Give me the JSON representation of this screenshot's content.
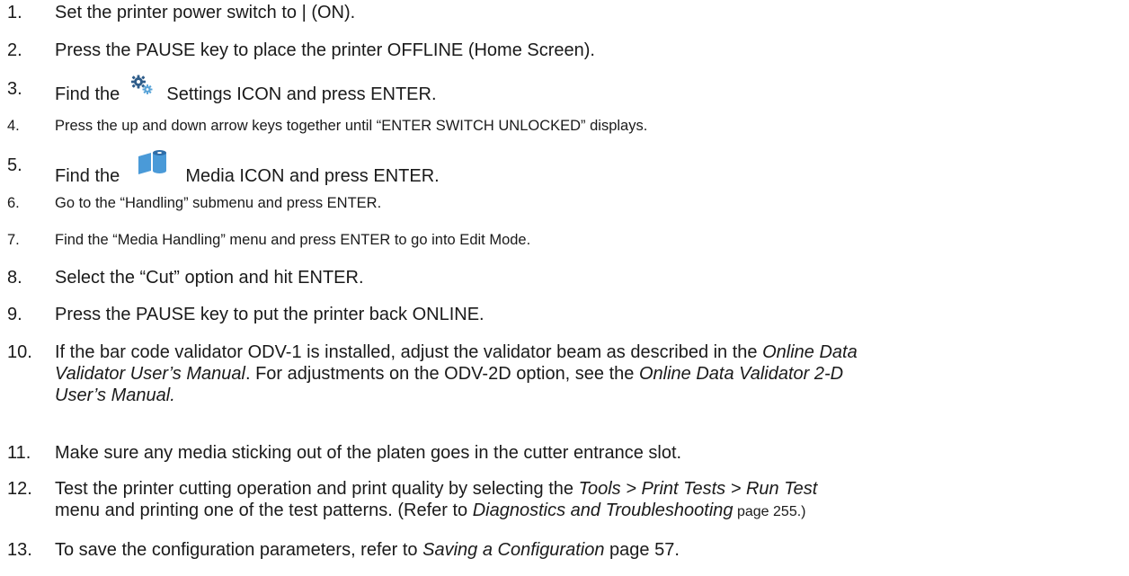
{
  "steps": [
    {
      "num": "1.",
      "text": "Set the printer power switch to | (ON)."
    },
    {
      "num": "2.",
      "text": "Press the PAUSE key to place the printer OFFLINE (Home Screen)."
    },
    {
      "num": "3.",
      "pre": "Find the",
      "icon": "settings-gear-icon",
      "post": "Settings ICON and press ENTER."
    },
    {
      "num": "4.",
      "text": "Press the up and down arrow keys together until “ENTER SWITCH UNLOCKED” displays."
    },
    {
      "num": "5.",
      "pre": "Find the",
      "icon": "media-roll-icon",
      "post": "Media ICON and press ENTER."
    },
    {
      "num": "6.",
      "text": "Go to the “Handling” submenu and press ENTER."
    },
    {
      "num": "7.",
      "text": "Find the “Media Handling” menu and press ENTER to go into Edit Mode."
    },
    {
      "num": "8.",
      "text": "Select the “Cut” option and hit ENTER."
    },
    {
      "num": "9.",
      "text": "Press the PAUSE key to put the printer back ONLINE."
    },
    {
      "num": "10.",
      "a": "If the bar code validator ODV-1 is installed, adjust the validator beam as described in the ",
      "b": "Online Data",
      "c": "Validator User’s Manual",
      "d": ". For adjustments on the ODV-2D option, see the ",
      "e": "Online Data Validator 2-D",
      "f": "User’s Manual."
    },
    {
      "num": "11.",
      "text": "Make sure any media sticking out of the platen goes in the cutter entrance  slot."
    },
    {
      "num": "12.",
      "a": "Test the printer cutting operation and print quality by selecting the  ",
      "b": "Tools > Print Tests > Run Test",
      "c": "menu and printing one of the test patterns.  (Refer to ",
      "d": "Diagnostics and Troubleshooting",
      "e": " page 255.)"
    },
    {
      "num": "13.",
      "a": "To save the configuration parameters, refer to ",
      "b": "Saving a Configuration",
      "c": " page 57."
    }
  ],
  "colors": {
    "text": "#1a1a1a",
    "gear_dark": "#2f5d8a",
    "gear_light": "#5aa4d8",
    "media_blue": "#4a9ad8",
    "media_dark": "#2e6da8"
  }
}
